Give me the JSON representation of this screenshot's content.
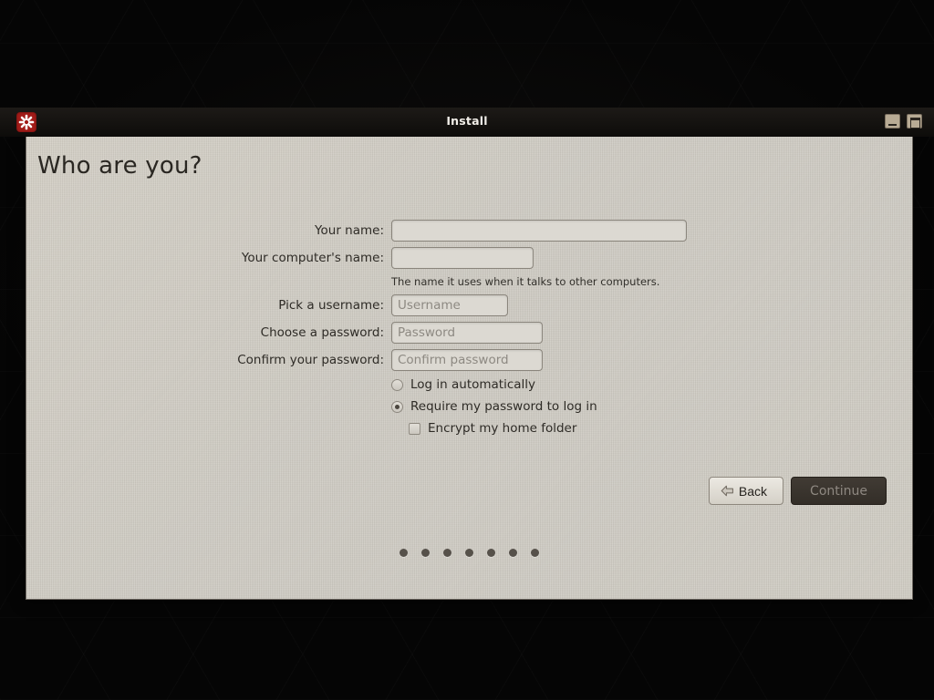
{
  "window": {
    "title": "Install",
    "icon": "ubuntu-installer-icon",
    "controls": [
      {
        "name": "minimize-button",
        "label": "Minimize"
      },
      {
        "name": "maximize-button",
        "label": "Maximize"
      }
    ]
  },
  "page": {
    "heading": "Who are you?"
  },
  "form": {
    "fields": [
      {
        "label": "Your name:",
        "value": "",
        "placeholder": ""
      },
      {
        "label": "Your computer's name:",
        "value": "",
        "placeholder": ""
      },
      {
        "label": "Pick a username:",
        "value": "",
        "placeholder": "Username"
      },
      {
        "label": "Choose a password:",
        "value": "",
        "placeholder": "Password"
      },
      {
        "label": "Confirm your password:",
        "value": "",
        "placeholder": "Confirm password"
      }
    ],
    "hints": {
      "computer_name": "The name it uses when it talks to other computers."
    },
    "options": [
      {
        "type": "radio",
        "label": "Log in automatically",
        "checked": false
      },
      {
        "type": "radio",
        "label": "Require my password to log in",
        "checked": true
      },
      {
        "type": "checkbox",
        "label": "Encrypt my home folder",
        "checked": false
      }
    ]
  },
  "footer": {
    "back_label": "Back",
    "continue_label": "Continue",
    "continue_disabled": true,
    "back_icon": "arrow-left-icon"
  },
  "progress": {
    "total_steps": 7,
    "current_step": 7,
    "dot_color": "#56514a"
  },
  "colors": {
    "window_background": "#cfccc4",
    "titlebar": "#15120f",
    "accent_icon": "#a21b18",
    "continue_button": "#3b352f",
    "text": "#2e2b26",
    "desktop": "#050505"
  }
}
